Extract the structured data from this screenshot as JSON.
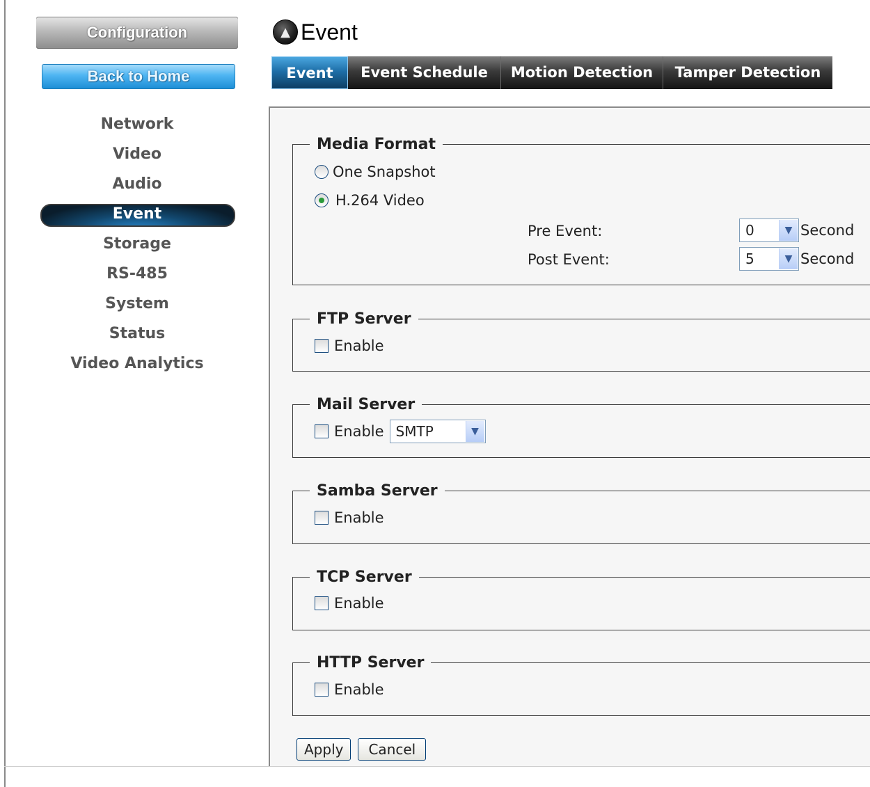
{
  "sidebar": {
    "config_label": "Configuration",
    "home_label": "Back to Home",
    "items": [
      {
        "label": "Network"
      },
      {
        "label": "Video"
      },
      {
        "label": "Audio"
      },
      {
        "label": "Event"
      },
      {
        "label": "Storage"
      },
      {
        "label": "RS-485"
      },
      {
        "label": "System"
      },
      {
        "label": "Status"
      },
      {
        "label": "Video Analytics"
      }
    ],
    "active_item": "Event"
  },
  "header": {
    "title": "Event"
  },
  "tabs": [
    {
      "label": "Event"
    },
    {
      "label": "Event Schedule"
    },
    {
      "label": "Motion Detection"
    },
    {
      "label": "Tamper Detection"
    }
  ],
  "media_format": {
    "legend": "Media Format",
    "option_snapshot": "One Snapshot",
    "option_video": "H.264 Video",
    "selected": "H.264 Video",
    "pre_event_label": "Pre Event:",
    "pre_event_value": "0",
    "post_event_label": "Post Event:",
    "post_event_value": "5",
    "unit": "Second"
  },
  "ftp": {
    "legend": "FTP Server",
    "enable_label": "Enable",
    "checked": false
  },
  "mail": {
    "legend": "Mail Server",
    "enable_label": "Enable",
    "checked": false,
    "protocol": "SMTP"
  },
  "samba": {
    "legend": "Samba Server",
    "enable_label": "Enable",
    "checked": false
  },
  "tcp": {
    "legend": "TCP Server",
    "enable_label": "Enable",
    "checked": false
  },
  "http": {
    "legend": "HTTP Server",
    "enable_label": "Enable",
    "checked": false
  },
  "actions": {
    "apply_label": "Apply",
    "cancel_label": "Cancel"
  },
  "colors": {
    "tab_active": "#1e6fa8",
    "home_button": "#4eb5f2",
    "nav_active": "#12486f"
  }
}
